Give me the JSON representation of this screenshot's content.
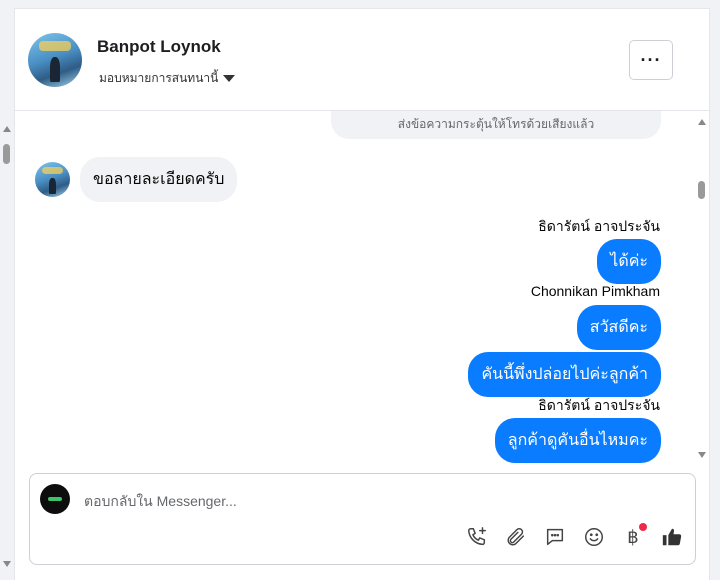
{
  "header": {
    "contact_name": "Banpot Loynok",
    "assign_label": "มอบหมายการสนทนานี้",
    "more_label": "···"
  },
  "messages": {
    "system_note": "ส่งข้อความกระตุ้นให้โทรด้วยเสียงแล้ว",
    "incoming_1": "ขอลายละเอียดครับ",
    "sender_1": "ธิดารัตน์ อาจประจัน",
    "out_1": "ได้ค่ะ",
    "sender_2": "Chonnikan Pimkham",
    "out_2": "สวัสดีคะ",
    "out_3": "คันนี้พึ่งปล่อยไปค่ะลูกค้า",
    "sender_3": "ธิดารัตน์ อาจประจัน",
    "out_4": "ลูกค้าดูคันอื่นไหมคะ"
  },
  "composer": {
    "placeholder": "ตอบกลับใน Messenger...",
    "baht_symbol": "฿"
  },
  "colors": {
    "accent": "#0a7cff",
    "badge": "#f02849"
  }
}
